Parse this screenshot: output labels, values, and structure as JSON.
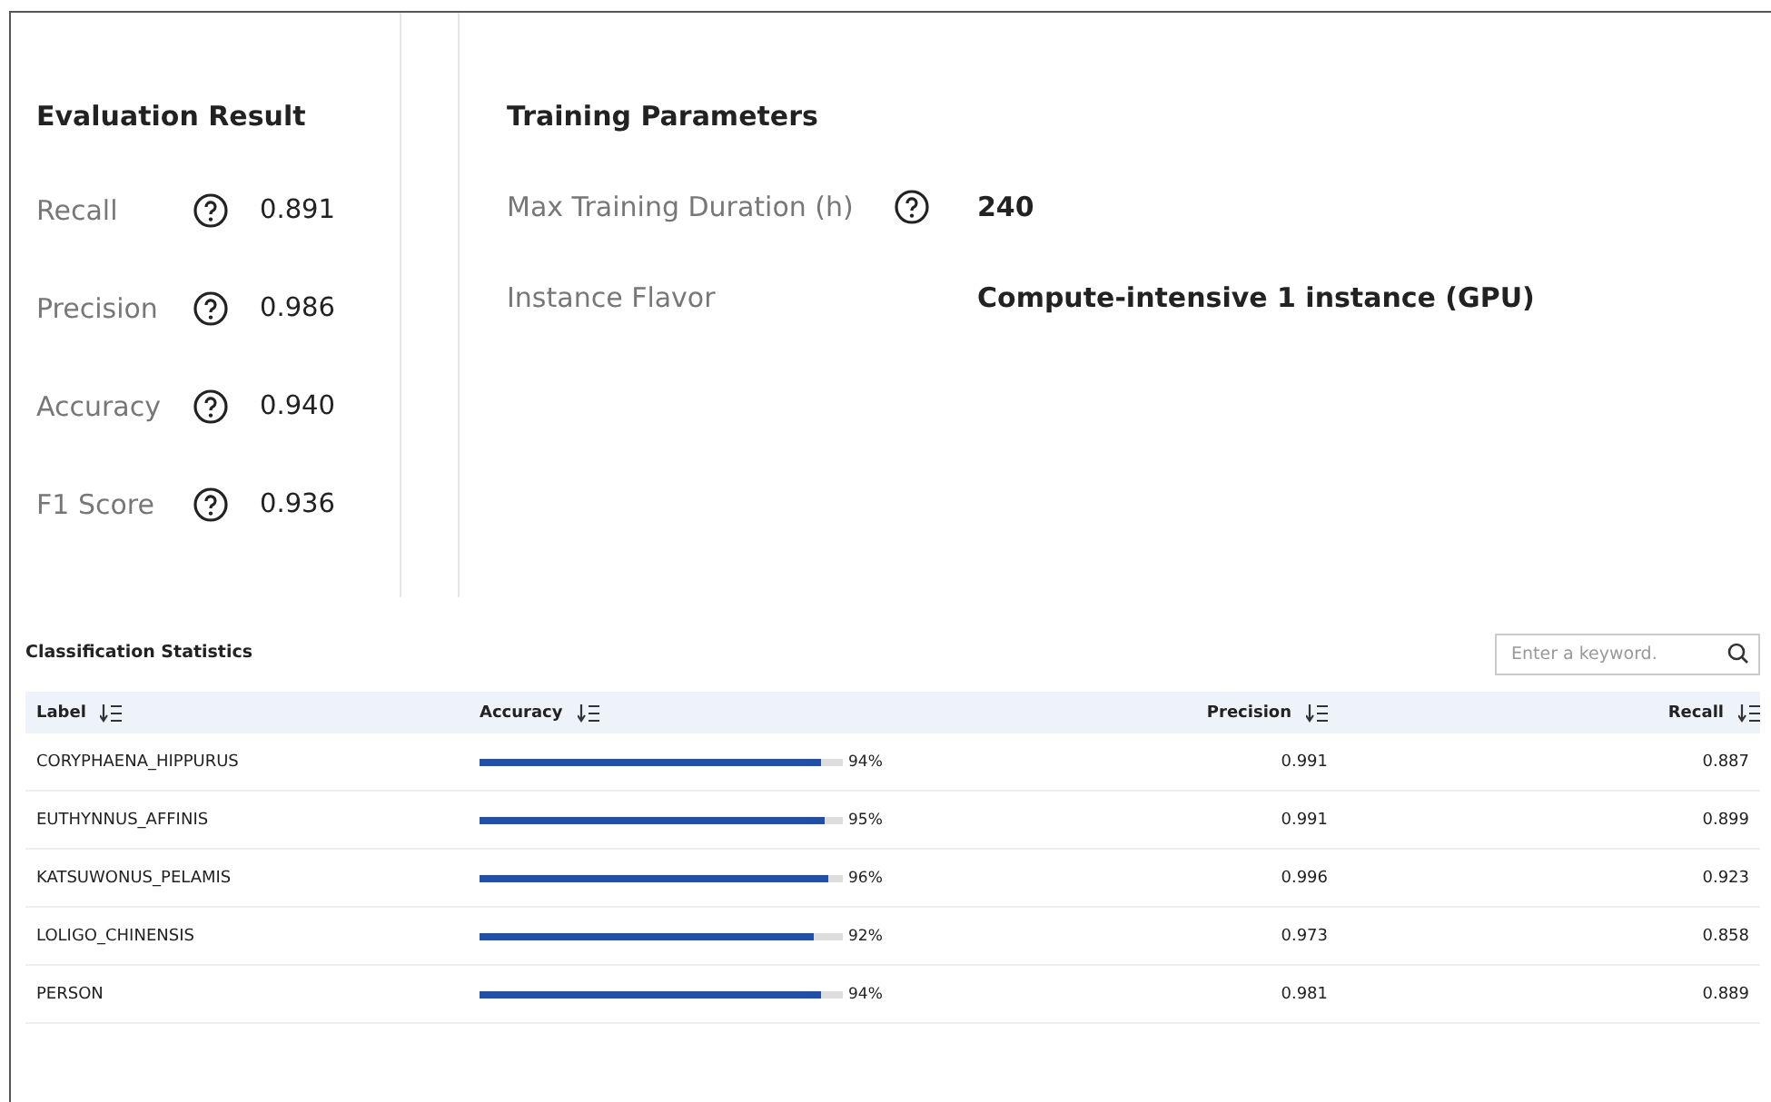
{
  "evaluation": {
    "title": "Evaluation Result",
    "metrics": [
      {
        "label": "Recall",
        "value": "0.891"
      },
      {
        "label": "Precision",
        "value": "0.986"
      },
      {
        "label": "Accuracy",
        "value": "0.940"
      },
      {
        "label": "F1 Score",
        "value": "0.936"
      }
    ]
  },
  "training": {
    "title": "Training Parameters",
    "params": [
      {
        "label": "Max Training Duration (h)",
        "help": true,
        "value": "240"
      },
      {
        "label": "Instance Flavor",
        "help": false,
        "value": "Compute-intensive 1 instance (GPU)"
      }
    ]
  },
  "statistics": {
    "title": "Classification Statistics",
    "search": {
      "placeholder": "Enter a keyword."
    },
    "columns": [
      "Label",
      "Accuracy",
      "Precision",
      "Recall"
    ],
    "rows": [
      {
        "label": "CORYPHAENA_HIPPURUS",
        "level": 0.94,
        "accuracy": "94%",
        "precision": "0.991",
        "recall": "0.887"
      },
      {
        "label": "EUTHYNNUS_AFFINIS",
        "level": 0.95,
        "accuracy": "95%",
        "precision": "0.991",
        "recall": "0.899"
      },
      {
        "label": "KATSUWONUS_PELAMIS",
        "level": 0.96,
        "accuracy": "96%",
        "precision": "0.996",
        "recall": "0.923"
      },
      {
        "label": "LOLIGO_CHINENSIS",
        "level": 0.92,
        "accuracy": "92%",
        "precision": "0.973",
        "recall": "0.858"
      },
      {
        "label": "PERSON",
        "level": 0.94,
        "accuracy": "94%",
        "precision": "0.981",
        "recall": "0.889"
      }
    ]
  }
}
